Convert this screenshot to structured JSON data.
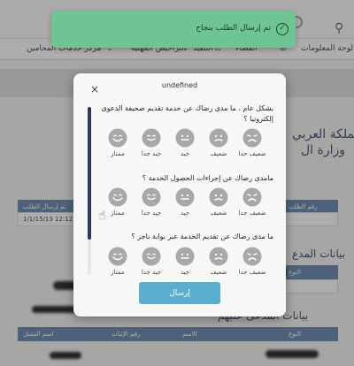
{
  "toast": {
    "message": "تم إرسال الطلب بنجاح"
  },
  "nav": {
    "items": [
      "لوحة المعلومات",
      "القضاء",
      "التنفيذ",
      "التراخيص المهنية",
      "مركز خدمات المحامين"
    ]
  },
  "background": {
    "heading_1": "المملكة العربي",
    "heading_2": "وزارة ال",
    "table_header_1": "رقم الطلب",
    "table_header_2": "تم إرسال الطلب",
    "table_value_1": "1/1/15/13 12:12:2",
    "section_1": "بيانات المدع",
    "field_type_1": "النوع",
    "section_2": "بيانات المدعى عليهم",
    "table2_headers": [
      "النوع",
      "الاسم",
      "رقم الإثبات",
      "اسم الممثل"
    ]
  },
  "modal": {
    "title": "undefined",
    "close": "×",
    "send_label": "إرسال",
    "questions": [
      {
        "text_line1": "بشكل عام ، ما مدى رضاك عن خدمة تقديم صحيفة الدعوى",
        "text_line2": "إلكترونيا ؟",
        "options": [
          "ضعيف جدا",
          "ضعيف",
          "جيد",
          "جيد جدا",
          "ممتاز"
        ]
      },
      {
        "text_line1": "مامدى رضاك عن إجراءات الحصول الخدمة ؟",
        "options": [
          "ضعيف جدا",
          "ضعيف",
          "جيد",
          "جيد جدا",
          "ممتاز"
        ]
      },
      {
        "text_line1": "ما مدى رضاك عن تقديم الخدمة عبر بوابة ناجز ؟",
        "options": [
          "ضعيف جدا",
          "ضعيف",
          "جيد",
          "جيد جدا",
          "ممتاز"
        ]
      }
    ]
  },
  "colors": {
    "toast_bg": "#6ec492",
    "send_button": "#5aaed0",
    "scroll_thumb": "#2a3a60"
  }
}
